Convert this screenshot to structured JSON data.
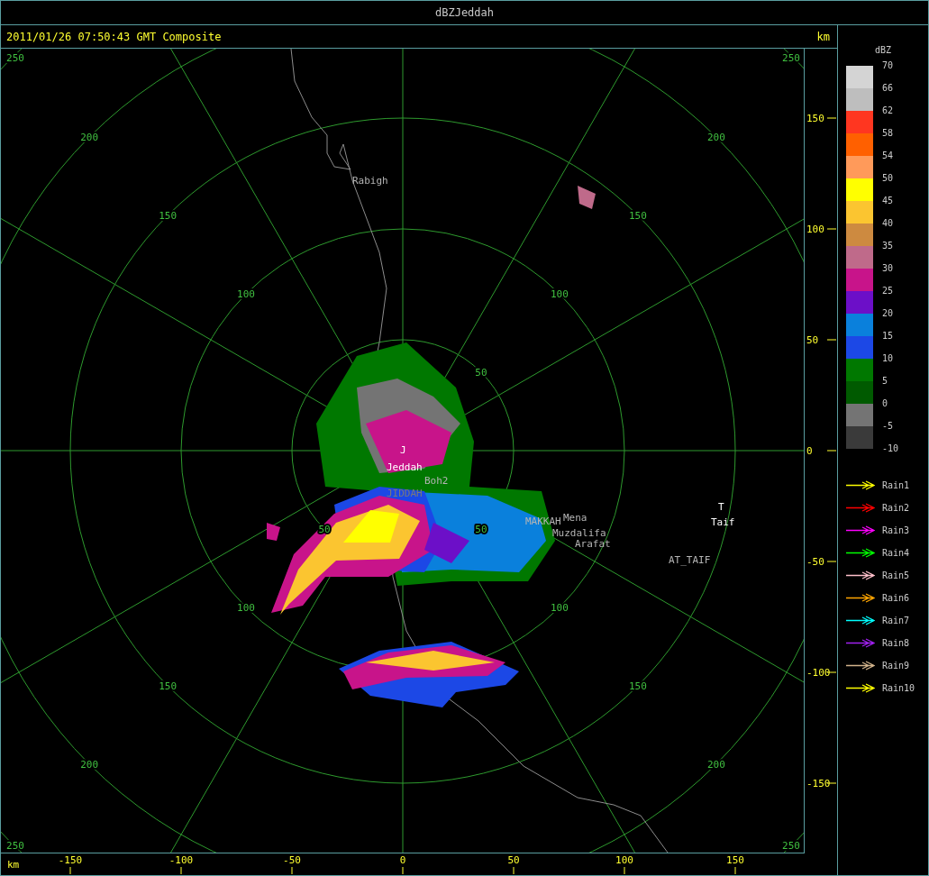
{
  "window": {
    "title": "dBZJeddah"
  },
  "header": {
    "timestamp": "2011/01/26 07:50:43 GMT Composite",
    "units": "km"
  },
  "plot": {
    "ring_labels": [
      "250",
      "250",
      "200",
      "200",
      "150",
      "150",
      "100",
      "100",
      "50",
      "50",
      "50",
      "100",
      "100",
      "150",
      "150",
      "200",
      "200",
      "250",
      "250"
    ],
    "places": [
      {
        "name": "Rabigh",
        "kind": "landmark"
      },
      {
        "name": "J",
        "kind": "site"
      },
      {
        "name": "Jeddah",
        "kind": "site"
      },
      {
        "name": "Boh2",
        "kind": "landmark"
      },
      {
        "name": "JIDDAH",
        "kind": "faint"
      },
      {
        "name": "T",
        "kind": "site"
      },
      {
        "name": "MAKKAH",
        "kind": "landmark"
      },
      {
        "name": "Mena",
        "kind": "landmark"
      },
      {
        "name": "Muzdalifa",
        "kind": "landmark"
      },
      {
        "name": "Taif",
        "kind": "site"
      },
      {
        "name": "Arafat",
        "kind": "landmark"
      },
      {
        "name": "AT_TAIF",
        "kind": "landmark"
      }
    ]
  },
  "y_axis": {
    "ticks": [
      "150",
      "100",
      "50",
      "0",
      "-50",
      "-100",
      "-150"
    ]
  },
  "x_axis": {
    "label": "km",
    "ticks": [
      "-150",
      "-100",
      "-50",
      "0",
      "50",
      "100",
      "150"
    ]
  },
  "legend": {
    "title": "dBZ",
    "labels": [
      "70",
      "66",
      "62",
      "58",
      "54",
      "50",
      "45",
      "40",
      "35",
      "30",
      "25",
      "20",
      "15",
      "10",
      "5",
      "0",
      "-5",
      "-10"
    ],
    "swatches": [
      {
        "color": "#d4d4d4"
      },
      {
        "color": "#bebebe"
      },
      {
        "color": "#ff3620"
      },
      {
        "color": "#ff6000"
      },
      {
        "color": "#ff9a5a"
      },
      {
        "color": "#ffff00"
      },
      {
        "color": "#fbc530"
      },
      {
        "color": "#cd8a40"
      },
      {
        "color": "#bf6a8a"
      },
      {
        "color": "#c8148a"
      },
      {
        "color": "#6c0fc8"
      },
      {
        "color": "#0a80dc"
      },
      {
        "color": "#1c48e6"
      },
      {
        "color": "#007800"
      },
      {
        "color": "#005a00"
      },
      {
        "color": "#747474"
      },
      {
        "color": "#3a3a3a"
      }
    ]
  },
  "tracks": [
    {
      "label": "Rain1",
      "color": "#ffff00"
    },
    {
      "label": "Rain2",
      "color": "#ff0000"
    },
    {
      "label": "Rain3",
      "color": "#ff00ff"
    },
    {
      "label": "Rain4",
      "color": "#00ff00"
    },
    {
      "label": "Rain5",
      "color": "#ffc0cb"
    },
    {
      "label": "Rain6",
      "color": "#ffa500"
    },
    {
      "label": "Rain7",
      "color": "#00ffff"
    },
    {
      "label": "Rain8",
      "color": "#a020f0"
    },
    {
      "label": "Rain9",
      "color": "#d2b48c"
    },
    {
      "label": "Rain10",
      "color": "#ffff00"
    }
  ]
}
